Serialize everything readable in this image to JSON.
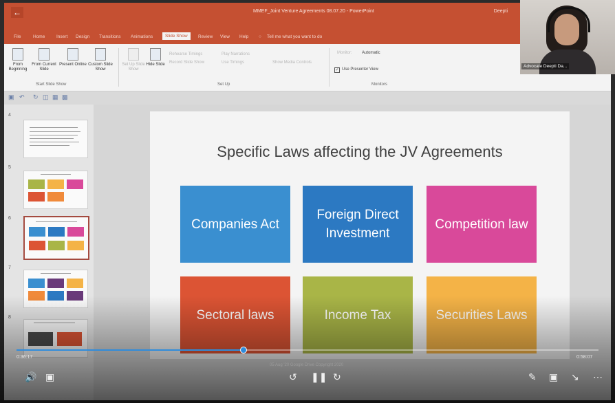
{
  "ppt": {
    "doc_title": "MMEF_Joint Venture Agreements 08.07.20 - PowerPoint",
    "user": "Deepti",
    "tabs": [
      "File",
      "Home",
      "Insert",
      "Design",
      "Transitions",
      "Animations",
      "Slide Show",
      "Review",
      "View",
      "Help",
      "Tell me what you want to do"
    ],
    "active_tab": "Slide Show",
    "start_group": {
      "from_beginning": "From Beginning",
      "from_current": "From Current Slide",
      "present_online": "Present Online",
      "custom_show": "Custom Slide Show",
      "label": "Start Slide Show"
    },
    "setup_group": {
      "setup": "Set Up Slide Show",
      "hide": "Hide Slide",
      "rehearse": "Rehearse Timings",
      "record": "Record Slide Show",
      "play_narrations": "Play Narrations",
      "use_timings": "Use Timings",
      "show_media": "Show Media Controls",
      "label": "Set Up"
    },
    "monitors_group": {
      "monitor_label": "Monitor:",
      "monitor_value": "Automatic",
      "presenter_view": "Use Presenter View",
      "label": "Monitors"
    }
  },
  "thumbnails": [
    {
      "num": "4"
    },
    {
      "num": "5"
    },
    {
      "num": "6",
      "selected": true
    },
    {
      "num": "7"
    },
    {
      "num": "8"
    }
  ],
  "slide": {
    "title": "Specific Laws affecting the JV Agreements",
    "boxes": [
      {
        "label": "Companies Act",
        "color": "#3a8fd0"
      },
      {
        "label": "Foreign Direct Investment",
        "color": "#2c79c2"
      },
      {
        "label": "Competition law",
        "color": "#d9499a"
      },
      {
        "label": "Sectoral laws",
        "color": "#dc5434"
      },
      {
        "label": "Income Tax",
        "color": "#a9b547"
      },
      {
        "label": "Securities Laws",
        "color": "#f4b347"
      }
    ]
  },
  "webcam": {
    "name": "Advocate Deepti Da..."
  },
  "player": {
    "elapsed": "0:36:17",
    "total": "0:58:07",
    "progress": 0.39,
    "footer": "05 Aug '20 Google Drive Copyright 2020"
  },
  "colors": {
    "ribbon": "#c55032",
    "progress": "#2f8cdc"
  }
}
